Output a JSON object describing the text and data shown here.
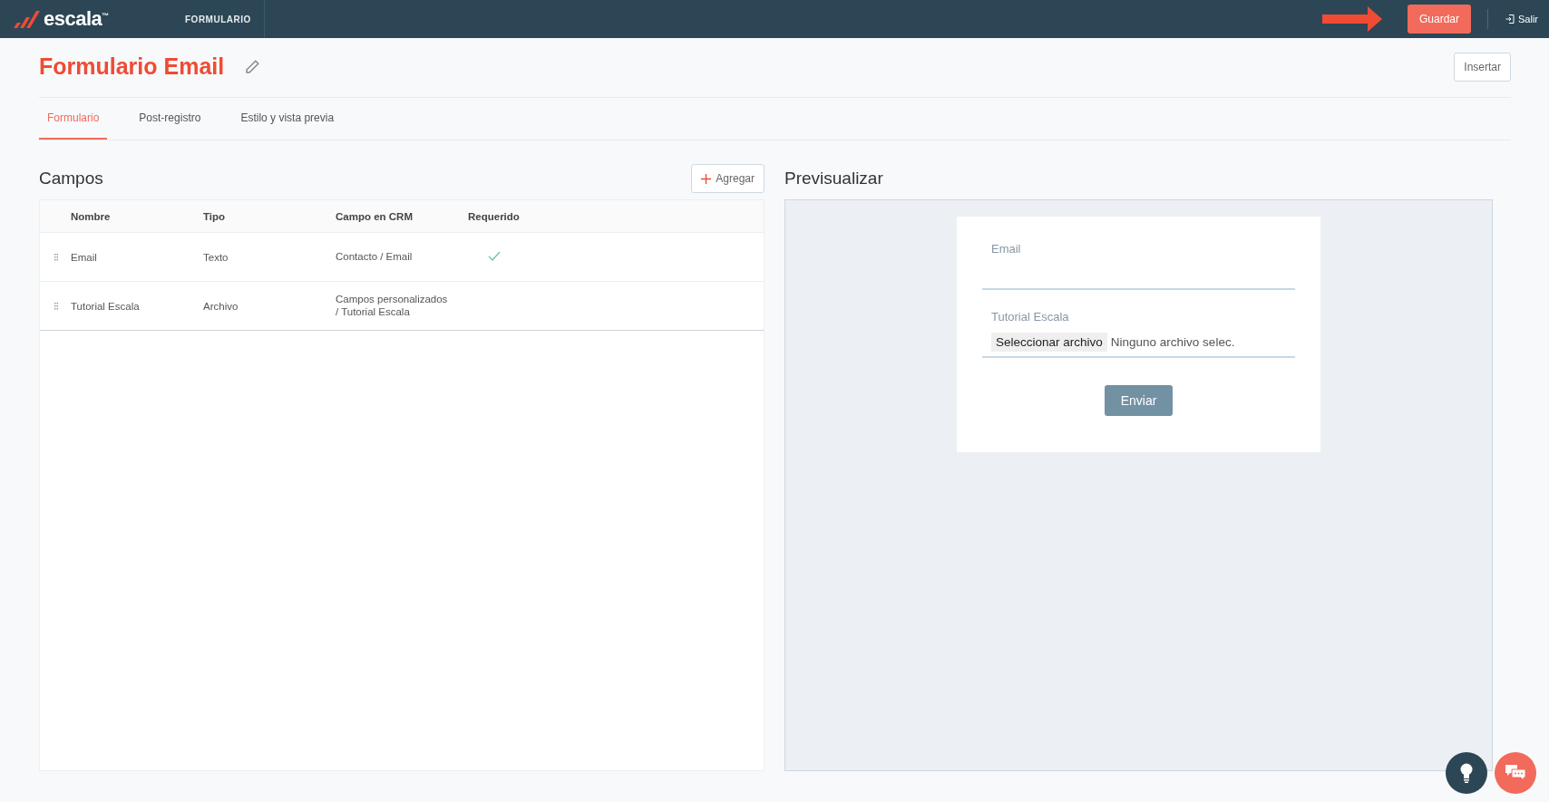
{
  "header": {
    "logo_text": "escala",
    "logo_trademark": "™",
    "section": "FORMULARIO",
    "save_button": "Guardar",
    "exit_link": "Salir"
  },
  "page": {
    "title": "Formulario Email",
    "insert_button": "Insertar"
  },
  "tabs": [
    {
      "label": "Formulario",
      "selected": true
    },
    {
      "label": "Post-registro",
      "selected": false
    },
    {
      "label": "Estilo y vista previa",
      "selected": false
    }
  ],
  "fields_panel": {
    "title": "Campos",
    "add_button": "Agregar",
    "columns": [
      "Nombre",
      "Tipo",
      "Campo en CRM",
      "Requerido"
    ],
    "rows": [
      {
        "name": "Email",
        "type": "Texto",
        "crm_field": "Contacto / Email",
        "required": true
      },
      {
        "name": "Tutorial Escala",
        "type": "Archivo",
        "crm_field": "Campos personalizados / Tutorial Escala",
        "required": false
      }
    ]
  },
  "preview": {
    "title": "Previsualizar",
    "fields": [
      {
        "kind": "text",
        "label": "Email"
      },
      {
        "kind": "file",
        "label": "Tutorial Escala",
        "button": "Seleccionar archivo",
        "status": "Ninguno archivo selec."
      }
    ],
    "submit": "Enviar"
  }
}
